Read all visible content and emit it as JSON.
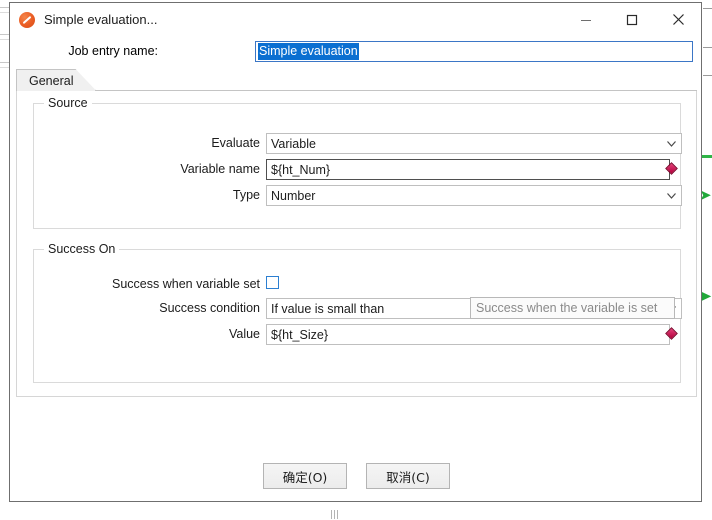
{
  "window": {
    "title": "Simple evaluation...",
    "icon": "orange-slash-icon",
    "controls": {
      "minimize": "minimize-icon",
      "maximize": "maximize-icon",
      "close": "close-icon"
    }
  },
  "job_entry": {
    "label": "Job entry name:",
    "value": "Simple evaluation",
    "placeholder": ""
  },
  "tabs": [
    {
      "label": "General",
      "selected": true
    }
  ],
  "source_group": {
    "title": "Source",
    "fields": [
      {
        "label": "Evaluate",
        "value": "Variable",
        "type": "combo"
      },
      {
        "label": "Variable name",
        "value": "${ht_Num}",
        "type": "text-with-variable"
      },
      {
        "label": "Type",
        "value": "Number",
        "type": "combo"
      }
    ]
  },
  "success_group": {
    "title": "Success On",
    "checkbox": {
      "label": "Success when variable set",
      "checked": false
    },
    "fields": [
      {
        "label": "Success condition",
        "value": "If value is small than",
        "type": "combo"
      },
      {
        "label": "Value",
        "value": "${ht_Size}",
        "type": "text-with-variable"
      }
    ]
  },
  "tooltip": {
    "text": "Success when the variable is set"
  },
  "buttons": {
    "ok": "确定(O)",
    "cancel": "取消(C)"
  },
  "colors": {
    "accent": "#0b6fd1",
    "focus_border": "#3b76c6",
    "variable_marker": "#b3003b",
    "app_icon": "#ea5c23",
    "background_arrow": "#21a83a"
  }
}
